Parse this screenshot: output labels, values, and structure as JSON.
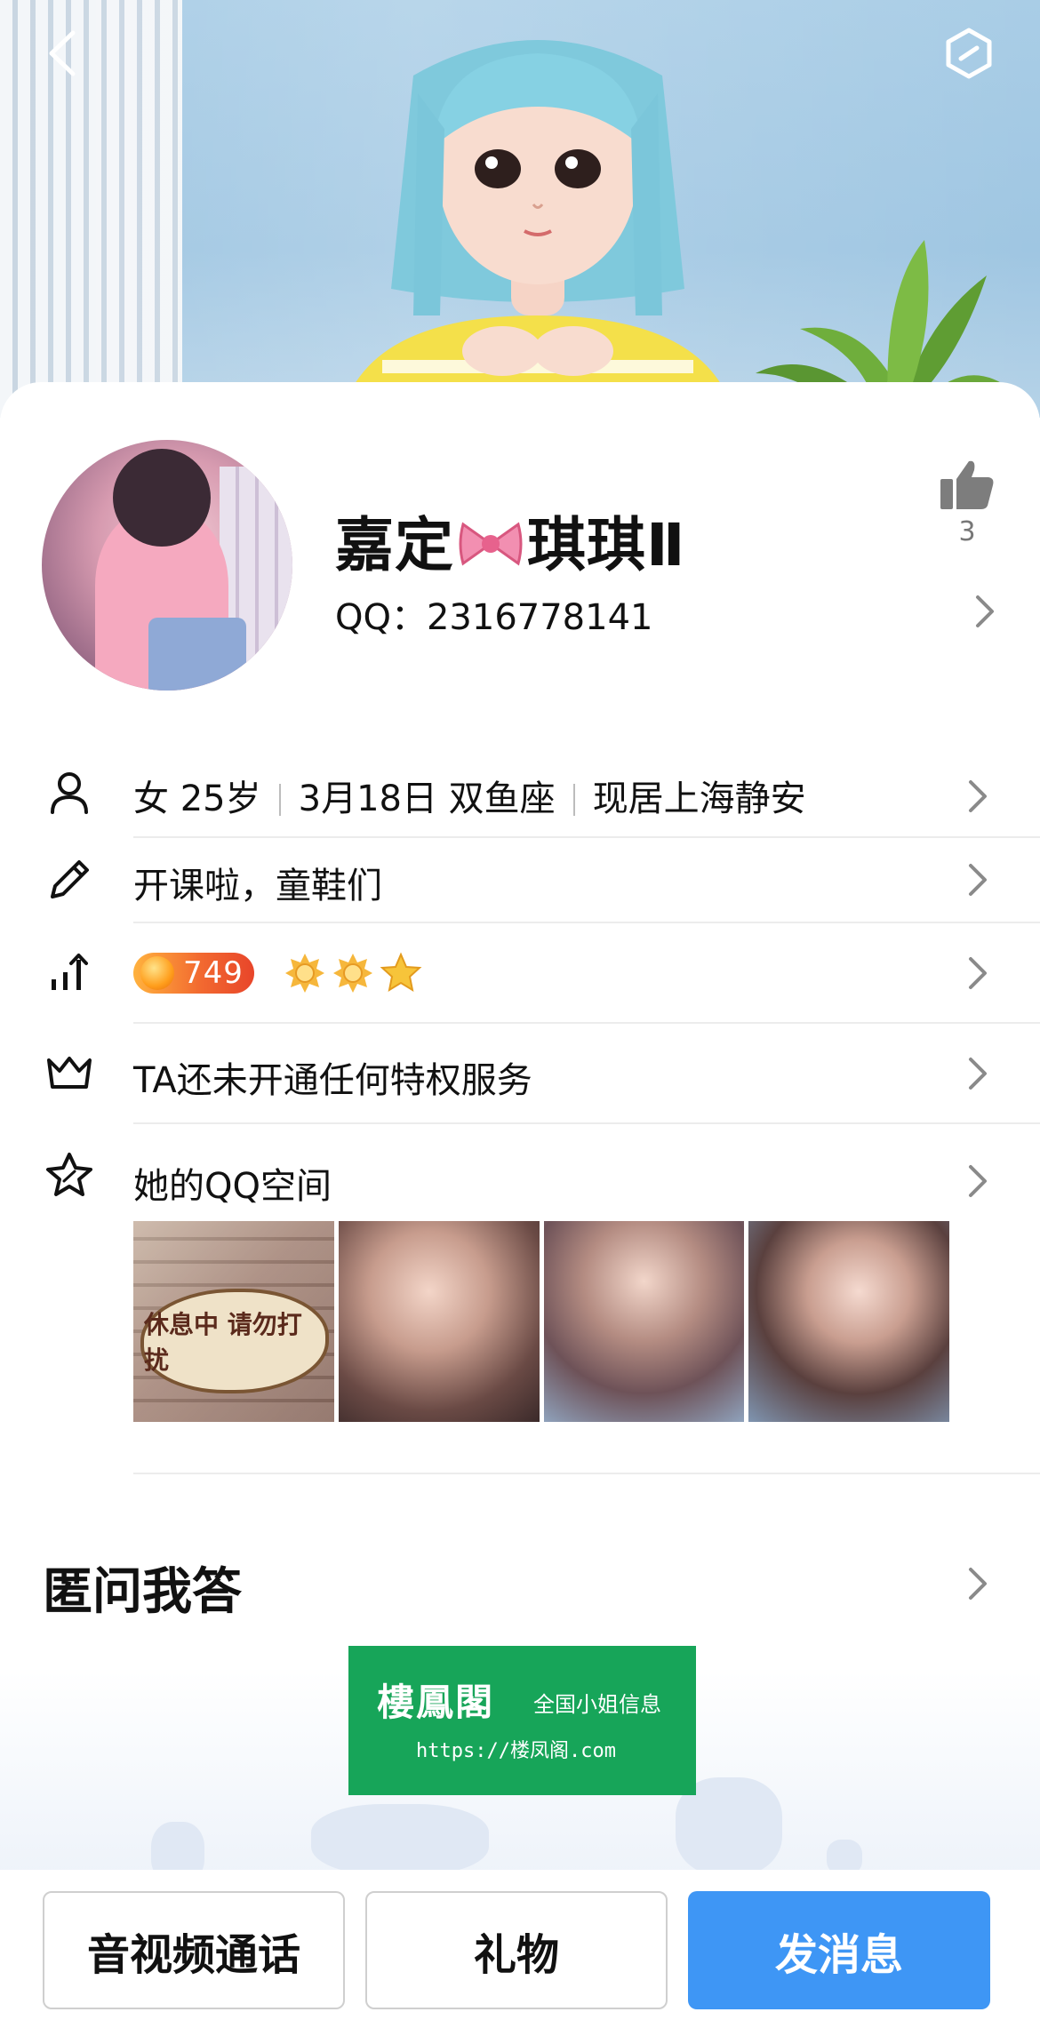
{
  "header": {
    "back_icon": "chevron-left-icon",
    "menu_icon": "hexagon-menu-icon"
  },
  "profile": {
    "nickname_part1": "嘉定",
    "nickname_emoji": "bow-icon",
    "nickname_part2": "琪琪Ⅱ",
    "qq_label": "QQ：",
    "qq_number": "2316778141",
    "like_count": "3"
  },
  "info": {
    "gender": "女",
    "age": "25岁",
    "birthday": "3月18日 双鱼座",
    "location": "现居上海静安",
    "signature": "开课啦，童鞋们",
    "level": "749",
    "level_icons": [
      "sun-icon",
      "sun-icon",
      "star-icon"
    ],
    "privilege": "TA还未开通任何特权服务",
    "qzone": "她的QQ空间",
    "qzone_sign_text": "休息中 请勿打扰"
  },
  "section": {
    "title": "匿问我答"
  },
  "ad": {
    "main": "樓鳳閣",
    "sub": "全国小姐信息",
    "url": "https://楼凤阁.com"
  },
  "actions": {
    "call": "音视频通话",
    "gift": "礼物",
    "message": "发消息"
  },
  "colors": {
    "primary": "#3e96f5",
    "banner": "#a9cde6",
    "ad_green": "#17a559",
    "level_orange": "#f26a30"
  }
}
